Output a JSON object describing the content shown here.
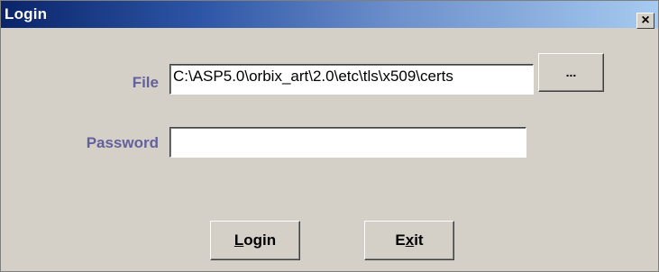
{
  "window": {
    "title": "Login",
    "close_label": "×"
  },
  "form": {
    "file_label": "File",
    "file_value": "C:\\ASP5.0\\orbix_art\\2.0\\etc\\tls\\x509\\certs",
    "password_label": "Password",
    "password_value": ""
  },
  "buttons": {
    "browse_label": "...",
    "login_mnemonic": "L",
    "login_rest": "ogin",
    "exit_start": "E",
    "exit_mnemonic": "x",
    "exit_rest": "it"
  },
  "colors": {
    "title_start": "#0a246a",
    "title_end": "#a6caf0",
    "label": "#64609c",
    "background": "#d4d0c8"
  }
}
